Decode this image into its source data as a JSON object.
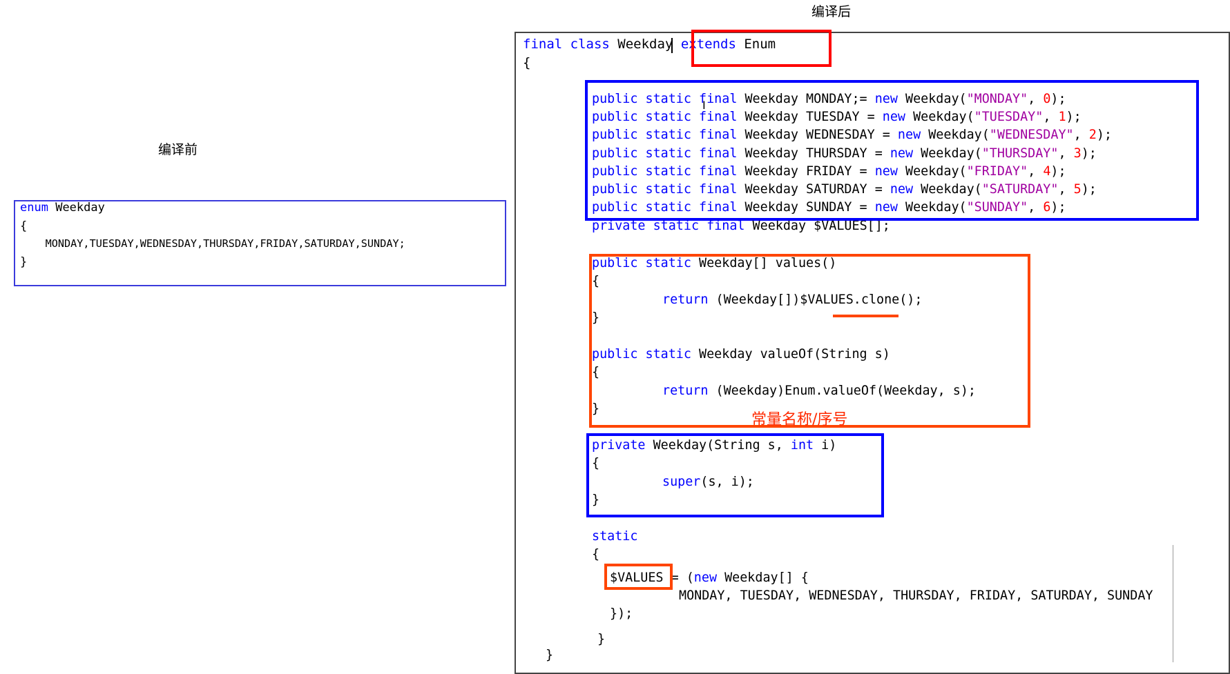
{
  "left": {
    "caption": "编译前",
    "lines": [
      "enum Weekday",
      "{",
      "    MONDAY,TUESDAY,WEDNESDAY,THURSDAY,FRIDAY,SATURDAY,SUNDAY;",
      "}"
    ]
  },
  "right": {
    "caption": "编译后",
    "lines": [
      {
        "text": "final class Weekday extends Enum"
      },
      {
        "text": "{"
      },
      {
        "text": "public static final Weekday MONDAY;= new Weekday(\"MONDAY\", 0);"
      },
      {
        "text": "public static final Weekday TUESDAY = new Weekday(\"TUESDAY\", 1);"
      },
      {
        "text": "public static final Weekday WEDNESDAY = new Weekday(\"WEDNESDAY\", 2);"
      },
      {
        "text": "public static final Weekday THURSDAY = new Weekday(\"THURSDAY\", 3);"
      },
      {
        "text": "public static final Weekday FRIDAY = new Weekday(\"FRIDAY\", 4);"
      },
      {
        "text": "public static final Weekday SATURDAY = new Weekday(\"SATURDAY\", 5);"
      },
      {
        "text": "public static final Weekday SUNDAY = new Weekday(\"SUNDAY\", 6);"
      },
      {
        "text": "private static final Weekday $VALUES[];"
      },
      {
        "text": "public static Weekday[] values()"
      },
      {
        "text": "{"
      },
      {
        "text": "return (Weekday[])$VALUES.clone();"
      },
      {
        "text": "}"
      },
      {
        "text": "public static Weekday valueOf(String s)"
      },
      {
        "text": "{"
      },
      {
        "text": "return (Weekday)Enum.valueOf(Weekday, s);"
      },
      {
        "text": "}"
      },
      {
        "text": "private Weekday(String s, int i)"
      },
      {
        "text": "{"
      },
      {
        "text": "super(s, i);"
      },
      {
        "text": "}"
      },
      {
        "text": "static"
      },
      {
        "text": "{"
      },
      {
        "text": "$VALUES = (new Weekday[] {"
      },
      {
        "text": "MONDAY, TUESDAY, WEDNESDAY, THURSDAY, FRIDAY, SATURDAY, SUNDAY"
      },
      {
        "text": "});"
      },
      {
        "text": "}"
      },
      {
        "text": "}"
      }
    ],
    "annotation": "常量名称/序号"
  },
  "colors": {
    "keyword": "#0000ff",
    "string": "#a000a0",
    "number": "#ff0000",
    "box_red": "#ff0000",
    "box_blue": "#0000ff",
    "box_orange": "#ff4500"
  }
}
